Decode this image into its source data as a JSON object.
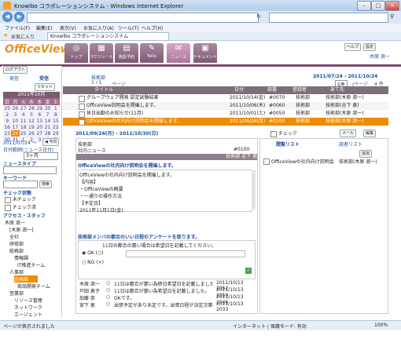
{
  "browser": {
    "title": "Knowlbo コラボレーションシステム - Windows Internet Explorer",
    "url": "",
    "menu": [
      "ファイル(F)",
      "編集(E)",
      "表示(V)",
      "お気に入り(A)",
      "ツール(T)",
      "ヘルプ(H)"
    ],
    "favorites_label": "お気に入り",
    "tab_title": "Knowlbo コラボレーションシステム",
    "status_left": "ページが表示されました",
    "status_zone": "インターネット | 保護モード: 有効",
    "zoom": "100%"
  },
  "app": {
    "logo": "OfficeView",
    "nav": [
      {
        "label": "トップ",
        "icon": "◎"
      },
      {
        "label": "スケジュール",
        "icon": "▦"
      },
      {
        "label": "施設予約",
        "icon": "▤"
      },
      {
        "label": "ToDo",
        "icon": "✎"
      },
      {
        "label": "ニュース",
        "icon": "✉"
      },
      {
        "label": "ドキュメント",
        "icon": "▣"
      }
    ],
    "logout": "ログアウト",
    "user": "木原 淑一",
    "header_links": [
      "ヘルプ",
      "設定"
    ]
  },
  "sidebar": {
    "tabs": [
      "発信",
      "受信"
    ],
    "refresh": "リセット",
    "calendar_title": "2011年10月",
    "weekdays": [
      "日",
      "月",
      "火",
      "水",
      "木",
      "金",
      "土"
    ],
    "weeks": [
      [
        "25",
        "26",
        "27",
        "28",
        "29",
        "30",
        "1"
      ],
      [
        "2",
        "3",
        "4",
        "5",
        "6",
        "7",
        "8"
      ],
      [
        "9",
        "10",
        "11",
        "12",
        "13",
        "14",
        "15"
      ],
      [
        "16",
        "17",
        "18",
        "19",
        "20",
        "21",
        "22"
      ],
      [
        "23",
        "24",
        "25",
        "26",
        "27",
        "28",
        "29"
      ],
      [
        "30",
        "31",
        "1",
        "2",
        "3",
        "4",
        "5"
      ]
    ],
    "date_range": "2011/07/24 ～",
    "date_back": "◀ 今日",
    "date_label": "日付範囲(ニュース日付)",
    "date_select": "3ヶ月",
    "news_type_label": "ニュースタイプ",
    "keyword_label": "キーワード",
    "search_btn": "検索",
    "check_label": "チェック状態",
    "check_items": [
      "未チェック",
      "チェック済"
    ],
    "staff_label": "アクセス・スタッフ",
    "tree": [
      "木原 淑一",
      "[木原 淑一]",
      "全社",
      "研修部",
      "総務部",
      "情報課",
      "IT推進チーム",
      "人事部",
      "企画部",
      "商品開発チーム",
      "営業部",
      "リソース管理",
      "ネットワーク",
      "エージェント"
    ]
  },
  "main": {
    "section": "技術部",
    "page": "1 / 1",
    "page_label": "ページ",
    "period": "2011/07/24 - 2011/10/24",
    "per_page": "5件",
    "per_page_suffix": "/ページ",
    "count": "4 件",
    "columns": [
      "タイトル",
      "日付",
      "部署",
      "登録者",
      "あて先"
    ],
    "rows": [
      {
        "title": "グループウェア開発 認定試験結果",
        "date": "2011/10/14(金)",
        "code": "#0070",
        "dept": "技術部",
        "to": "技術部(木原 淑一)"
      },
      {
        "title": "OfficeView説明会を開催します。",
        "date": "2011/10/06(木)",
        "code": "#0060",
        "dept": "技術部",
        "to": "技術部(吉下 恵)"
      },
      {
        "title": "休日出勤のお知らせ(11月)",
        "date": "2011/10/01(土)",
        "code": "#0050",
        "dept": "技術部",
        "to": "技術部(木原 淑一)"
      },
      {
        "title": "OfficeViewの社内向け説明会を開催します。",
        "date": "2011/09/26(月)",
        "code": "#0100",
        "dept": "技術部",
        "to": "技術部(木原 淑一)"
      }
    ],
    "detail_date": "2011/09/26(月) - 2011/10/30(日)",
    "check_btn": "チェック",
    "mail_btn": "メール",
    "edit_btn": "編集",
    "detail_dept": "技術部",
    "detail_type": "社内ニュース",
    "detail_no": "#0100",
    "detail_author": "技術部 吉下 恵",
    "detail_title": "OfficeViewの社内向け説明会を開催します。",
    "body": [
      "OfficeViewの社内向け説明会を開催します。",
      "【内容】",
      "・OfficeViewの概要",
      "・一通りの操作方法",
      "【予定日】",
      "2011年11月1日(金)"
    ],
    "survey_title": "技術部メンバの都合のいい日程のアンケートを取ります。",
    "survey_q": "11日の都合の悪い場合は希望日を記載してください。",
    "options": [
      "OK (○)",
      "NG (×)"
    ],
    "replies": [
      {
        "name": "木原 淑一",
        "mark": "○",
        "text": "11日は都合が悪い為終日希望日を記載しました。",
        "date": "2011/10/13 2052"
      },
      {
        "name": "戸田 恵子",
        "mark": "○",
        "text": "11日は都合が悪い為希望日を記載しました。",
        "date": "2011/10/13 2050"
      },
      {
        "name": "加藤 崇",
        "mark": "○",
        "text": "OKです。",
        "date": "2011/10/13 2046"
      },
      {
        "name": "宮下 恵",
        "mark": "○",
        "text": "出張予定があり未定です。出張日程が決定次第記載します。",
        "date": "2011/10/13 2033"
      }
    ]
  },
  "right": {
    "tabs": [
      "閲覧リスト",
      "読者リスト"
    ],
    "add_btn": "追加",
    "list": [
      {
        "title": "OfficeViewの社内向け説明会を開催",
        "who": "技術部(木原 淑一)"
      }
    ]
  }
}
